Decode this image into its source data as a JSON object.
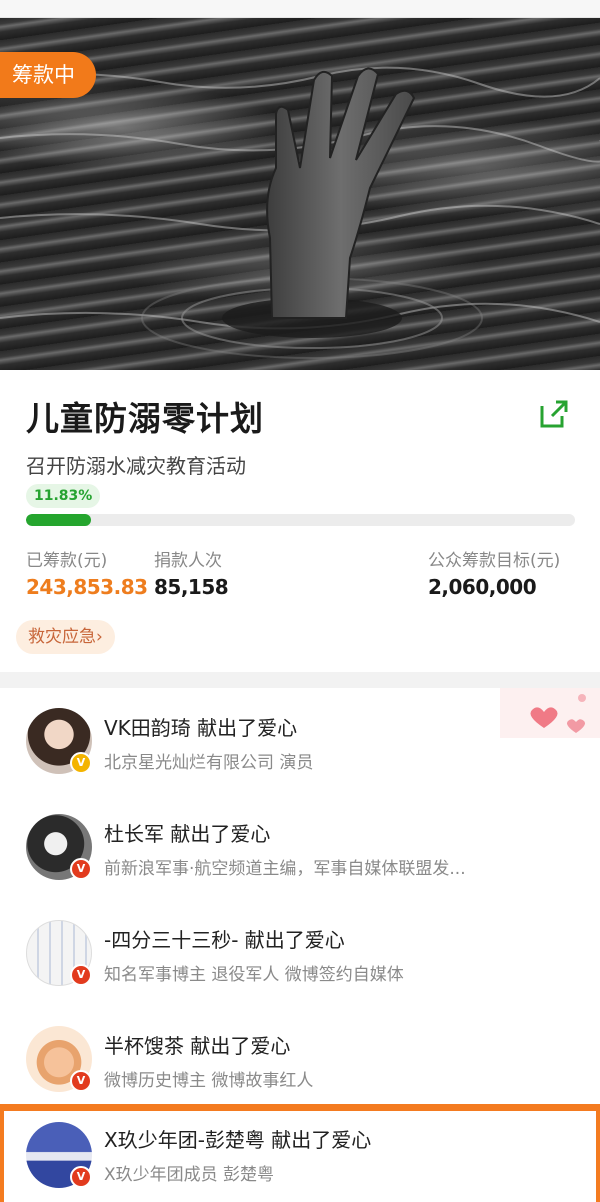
{
  "status_badge": "筹款中",
  "project": {
    "title": "儿童防溺零计划",
    "subtitle": "召开防溺水减灾教育活动",
    "progress_label": "11.83%",
    "progress_fraction": 0.1183
  },
  "stats": {
    "raised_label": "已筹款(元)",
    "raised_value": "243,853.83",
    "donors_label": "捐款人次",
    "donors_value": "85,158",
    "target_label": "公众筹款目标(元)",
    "target_value": "2,060,000"
  },
  "tag": "救灾应急",
  "tag_chevron": "›",
  "colors": {
    "accent_orange": "#f27a1a",
    "progress_green": "#25a52e",
    "verified_red": "#e23b1e",
    "verified_gold": "#f4b400"
  },
  "supporters": [
    {
      "name": "VK田韵琦 献出了爱心",
      "desc": "北京星光灿烂有限公司 演员",
      "badge": "V",
      "icon": "user-avatar"
    },
    {
      "name": "杜长军 献出了爱心",
      "desc": "前新浪军事·航空频道主编，军事自媒体联盟发...",
      "badge": "V",
      "icon": "user-avatar"
    },
    {
      "name": "-四分三十三秒- 献出了爱心",
      "desc": "知名军事博主 退役军人 微博签约自媒体",
      "badge": "V",
      "icon": "user-avatar"
    },
    {
      "name": "半杯馊茶 献出了爱心",
      "desc": "微博历史博主 微博故事红人",
      "badge": "V",
      "icon": "user-avatar"
    },
    {
      "name": "X玖少年团-彭楚粤 献出了爱心",
      "desc": "X玖少年团成员 彭楚粤",
      "badge": "V",
      "icon": "user-avatar"
    }
  ]
}
